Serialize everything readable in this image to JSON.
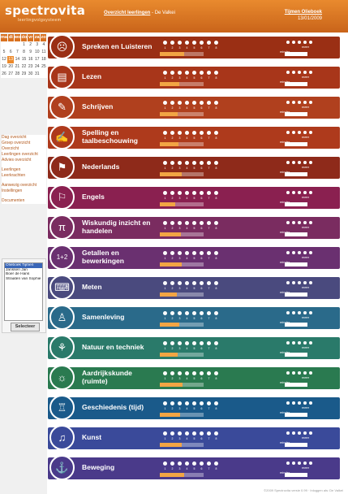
{
  "header": {
    "logo": "spectrovita",
    "logo_sub": "leerlingvolgsysteem",
    "crumb_link": "Overzicht leerlingen",
    "crumb_rest": "De Valkei",
    "user_name": "Tijmen Olieboek",
    "date": "13/01/2009"
  },
  "calendar": {
    "days": [
      "ma",
      "di",
      "wo",
      "do",
      "vr",
      "za",
      "zo"
    ],
    "cells": [
      "",
      "",
      "",
      "1",
      "2",
      "3",
      "4",
      "5",
      "6",
      "7",
      "8",
      "9",
      "10",
      "11",
      "12",
      "13",
      "14",
      "15",
      "16",
      "17",
      "18",
      "19",
      "20",
      "21",
      "22",
      "23",
      "24",
      "25",
      "26",
      "27",
      "28",
      "29",
      "30",
      "31",
      ""
    ],
    "today": "13"
  },
  "menu": {
    "day_overview": "Dag overzicht",
    "group_overview": "Groep overzicht",
    "overview": "Overzicht",
    "student_overview": "Leerlingen overzicht",
    "advice_overview": "Advies overzicht",
    "students": "Leerlingen",
    "teachers": "Leerkrachten",
    "notice": "Aanwezig overzicht",
    "settings": "Instellingen",
    "documents": "Documenten"
  },
  "students": {
    "list": [
      "Olieboek Tijmen",
      "Janssen Jan",
      "Boer de Hans",
      "Straaten van Sophie",
      "",
      "",
      "",
      "",
      "",
      "",
      ""
    ],
    "select_label": "Selecteer"
  },
  "subjects": [
    {
      "name": "Spreken en Luisteren",
      "color": "#9a2f14",
      "progress": 0.55
    },
    {
      "name": "Lezen",
      "color": "#a8361a",
      "progress": 0.45
    },
    {
      "name": "Schrijven",
      "color": "#b0401e",
      "progress": 0.4
    },
    {
      "name": "Spelling en taalbeschouwing",
      "color": "#ae3a1c",
      "progress": 0.42
    },
    {
      "name": "Nederlands",
      "color": "#8e2a1a",
      "progress": 0.5
    },
    {
      "name": "Engels",
      "color": "#8a2050",
      "progress": 0.35
    },
    {
      "name": "Wiskundig inzicht en handelen",
      "color": "#7a2c60",
      "progress": 0.48
    },
    {
      "name": "Getallen en bewerkingen",
      "color": "#6a3070",
      "progress": 0.5
    },
    {
      "name": "Meten",
      "color": "#4a4a7e",
      "progress": 0.38
    },
    {
      "name": "Samenleving",
      "color": "#2a6a8a",
      "progress": 0.45
    },
    {
      "name": "Natuur en techniek",
      "color": "#2a7a6a",
      "progress": 0.4
    },
    {
      "name": "Aardrijkskunde (ruimte)",
      "color": "#2a7a50",
      "progress": 0.52
    },
    {
      "name": "Geschiedenis (tijd)",
      "color": "#1a5a8a",
      "progress": 0.47
    },
    {
      "name": "Kunst",
      "color": "#3a4a9a",
      "progress": 0.5
    },
    {
      "name": "Beweging",
      "color": "#4a3a8a",
      "progress": 0.55
    }
  ],
  "tick_nums": [
    "1",
    "2",
    "3",
    "4",
    "5",
    "6",
    "7",
    "8"
  ],
  "labels": {
    "minder": "minder",
    "meer": "meer"
  },
  "footer": "©2009 Spectrovita versie 0.99 · Inloggen als: De Valkei"
}
